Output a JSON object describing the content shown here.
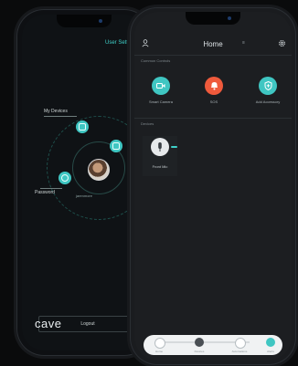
{
  "back_phone": {
    "title": "User Setting",
    "labels": {
      "my_devices": "My Devices",
      "password": "Password"
    },
    "username": "jarenmore",
    "logout_label": "Logout",
    "brand": "cave"
  },
  "front_phone": {
    "title": "Home",
    "house_selector": "≡",
    "sections": {
      "common_controls": "Common Controls",
      "devices": "Devices"
    },
    "actions": [
      {
        "label": "Smart Camera",
        "color": "#3fc6c2",
        "icon": "camera-icon"
      },
      {
        "label": "SOS",
        "color": "#ef5a3c",
        "icon": "bell-icon"
      },
      {
        "label": "Add Accessory",
        "color": "#3fc6c2",
        "icon": "shield-plus-icon"
      }
    ],
    "device": {
      "name": "Front Mic"
    },
    "tabs": [
      {
        "label": "Home"
      },
      {
        "label": "Devices"
      },
      {
        "label": "Automations"
      },
      {
        "label": "Alerts"
      }
    ]
  },
  "colors": {
    "accent": "#3fc6c2",
    "danger": "#ef5a3c",
    "background": "#0a0b0c"
  }
}
